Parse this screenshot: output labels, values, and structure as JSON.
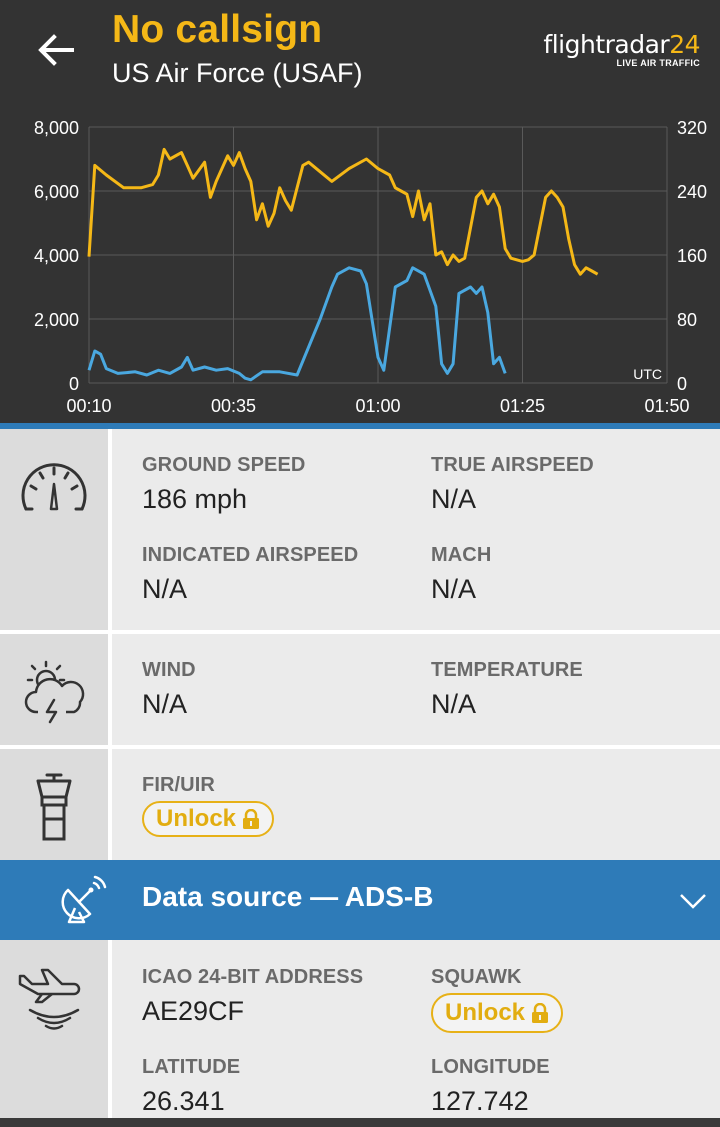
{
  "header": {
    "title": "No callsign",
    "subtitle": "US Air Force (USAF)",
    "logo_main": "flightradar",
    "logo_num": "24",
    "logo_tag": "LIVE AIR TRAFFIC"
  },
  "chart_data": {
    "type": "line",
    "x_ticks": [
      "00:10",
      "00:35",
      "01:00",
      "01:25",
      "01:50"
    ],
    "y_left_ticks": [
      "0",
      "2,000",
      "4,000",
      "6,000",
      "8,000"
    ],
    "y_right_ticks": [
      "0",
      "80",
      "160",
      "240",
      "320"
    ],
    "y_left_range": [
      0,
      8000
    ],
    "y_right_range": [
      0,
      320
    ],
    "timezone_label": "UTC",
    "grid": true,
    "series": [
      {
        "color": "#f5b817",
        "axis": "left",
        "points": [
          [
            0,
            3950
          ],
          [
            1,
            6800
          ],
          [
            3,
            6500
          ],
          [
            6,
            6100
          ],
          [
            9,
            6100
          ],
          [
            11,
            6200
          ],
          [
            12,
            6500
          ],
          [
            13,
            7300
          ],
          [
            14,
            7000
          ],
          [
            16,
            7200
          ],
          [
            17,
            6800
          ],
          [
            18,
            6400
          ],
          [
            20,
            6900
          ],
          [
            21,
            5800
          ],
          [
            22,
            6300
          ],
          [
            24,
            7100
          ],
          [
            25,
            6800
          ],
          [
            26,
            7200
          ],
          [
            27,
            6700
          ],
          [
            28,
            6300
          ],
          [
            29,
            5100
          ],
          [
            30,
            5600
          ],
          [
            31,
            4900
          ],
          [
            32,
            5300
          ],
          [
            33,
            6100
          ],
          [
            34,
            5700
          ],
          [
            35,
            5400
          ],
          [
            36,
            6100
          ],
          [
            37,
            6800
          ],
          [
            38,
            6900
          ],
          [
            40,
            6600
          ],
          [
            42,
            6300
          ],
          [
            45,
            6700
          ],
          [
            48,
            7000
          ],
          [
            50,
            6700
          ],
          [
            52,
            6500
          ],
          [
            53,
            6100
          ],
          [
            54,
            6000
          ],
          [
            55,
            5900
          ],
          [
            56,
            5200
          ],
          [
            57,
            6000
          ],
          [
            58,
            5100
          ],
          [
            59,
            5600
          ],
          [
            60,
            4000
          ],
          [
            61,
            4100
          ],
          [
            62,
            3700
          ],
          [
            63,
            4000
          ],
          [
            64,
            3800
          ],
          [
            65,
            3900
          ],
          [
            67,
            5800
          ],
          [
            68,
            6000
          ],
          [
            69,
            5600
          ],
          [
            70,
            5900
          ],
          [
            71,
            5500
          ],
          [
            72,
            4200
          ],
          [
            73,
            3900
          ],
          [
            75,
            3800
          ],
          [
            76,
            3850
          ],
          [
            77,
            4000
          ],
          [
            79,
            5800
          ],
          [
            80,
            6000
          ],
          [
            81,
            5800
          ],
          [
            82,
            5500
          ],
          [
            83,
            4500
          ],
          [
            84,
            3700
          ],
          [
            85,
            3400
          ],
          [
            86,
            3600
          ],
          [
            87,
            3500
          ],
          [
            88,
            3400
          ]
        ]
      },
      {
        "color": "#4aa8e0",
        "axis": "left",
        "points": [
          [
            0,
            400
          ],
          [
            1,
            1000
          ],
          [
            2,
            900
          ],
          [
            3,
            450
          ],
          [
            5,
            300
          ],
          [
            8,
            350
          ],
          [
            10,
            250
          ],
          [
            12,
            400
          ],
          [
            14,
            300
          ],
          [
            16,
            500
          ],
          [
            17,
            800
          ],
          [
            18,
            400
          ],
          [
            20,
            500
          ],
          [
            22,
            400
          ],
          [
            24,
            450
          ],
          [
            26,
            300
          ],
          [
            27,
            150
          ],
          [
            28,
            100
          ],
          [
            30,
            350
          ],
          [
            33,
            350
          ],
          [
            36,
            250
          ],
          [
            40,
            2000
          ],
          [
            42,
            3000
          ],
          [
            43,
            3400
          ],
          [
            45,
            3600
          ],
          [
            47,
            3500
          ],
          [
            48,
            3100
          ],
          [
            50,
            800
          ],
          [
            51,
            400
          ],
          [
            53,
            3000
          ],
          [
            55,
            3200
          ],
          [
            56,
            3600
          ],
          [
            58,
            3400
          ],
          [
            60,
            2400
          ],
          [
            61,
            600
          ],
          [
            62,
            300
          ],
          [
            63,
            600
          ],
          [
            64,
            2800
          ],
          [
            66,
            3000
          ],
          [
            67,
            2800
          ],
          [
            68,
            3000
          ],
          [
            69,
            2200
          ],
          [
            70,
            600
          ],
          [
            71,
            800
          ],
          [
            72,
            300
          ]
        ]
      }
    ],
    "x_total": 100
  },
  "speed": {
    "icon": "speedometer-icon",
    "ground_speed_label": "GROUND SPEED",
    "ground_speed_value": "186 mph",
    "true_airspeed_label": "TRUE AIRSPEED",
    "true_airspeed_value": "N/A",
    "indicated_airspeed_label": "INDICATED AIRSPEED",
    "indicated_airspeed_value": "N/A",
    "mach_label": "MACH",
    "mach_value": "N/A"
  },
  "weather": {
    "icon": "weather-storm-icon",
    "wind_label": "WIND",
    "wind_value": "N/A",
    "temperature_label": "TEMPERATURE",
    "temperature_value": "N/A"
  },
  "fir": {
    "icon": "control-tower-icon",
    "label": "FIR/UIR",
    "unlock_label": "Unlock"
  },
  "data_source": {
    "icon": "satellite-dish-icon",
    "label": "Data source — ADS-B",
    "chevron": "chevron-down-icon"
  },
  "adsb": {
    "icon": "aircraft-signal-icon",
    "icao_label": "ICAO 24-BIT ADDRESS",
    "icao_value": "AE29CF",
    "squawk_label": "SQUAWK",
    "squawk_unlock_label": "Unlock",
    "latitude_label": "LATITUDE",
    "latitude_value": "26.341",
    "longitude_label": "LONGITUDE",
    "longitude_value": "127.742"
  },
  "colors": {
    "accent": "#f5b817",
    "header_bg": "#333333",
    "data_source_bg": "#2e7bb8",
    "altitude_line": "#f5b817",
    "speed_line": "#4aa8e0"
  }
}
